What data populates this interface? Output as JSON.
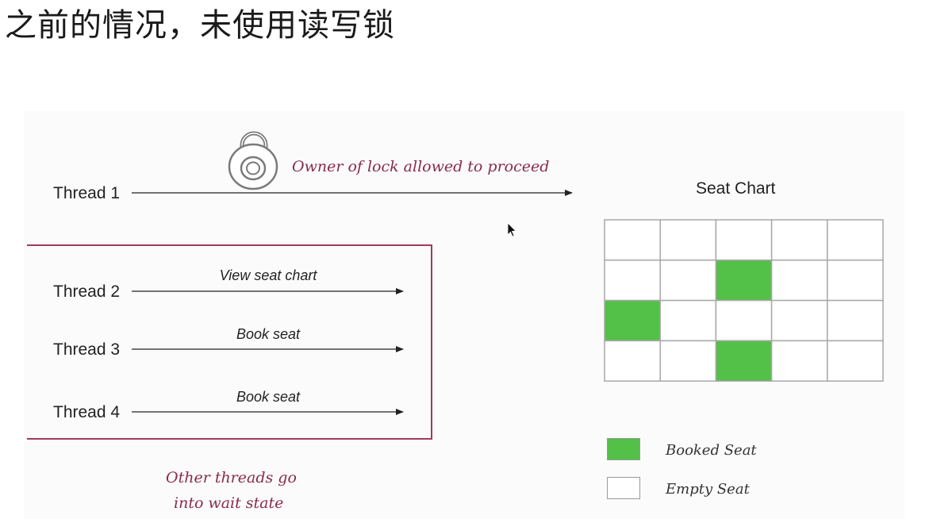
{
  "title": "之前的情况，未使用读写锁",
  "annotation_lock": "Owner of lock allowed to proceed",
  "annotation_wait": [
    "Other threads go",
    "into wait state"
  ],
  "threads": [
    {
      "label": "Thread 1",
      "action": ""
    },
    {
      "label": "Thread 2",
      "action": "View seat chart"
    },
    {
      "label": "Thread 3",
      "action": "Book seat"
    },
    {
      "label": "Thread 4",
      "action": "Book seat"
    }
  ],
  "seat_chart": {
    "title": "Seat Chart",
    "rows": 4,
    "cols": 5,
    "booked": [
      [
        1,
        2
      ],
      [
        2,
        0
      ],
      [
        3,
        2
      ]
    ],
    "booked_color": "#53c048",
    "empty_color": "#ffffff",
    "grid_color": "#a8a8a8"
  },
  "legend": {
    "booked_label": "Booked Seat",
    "empty_label": "Empty Seat"
  },
  "colors": {
    "accent": "#8a2a4b",
    "frame": "#a23a5c"
  }
}
